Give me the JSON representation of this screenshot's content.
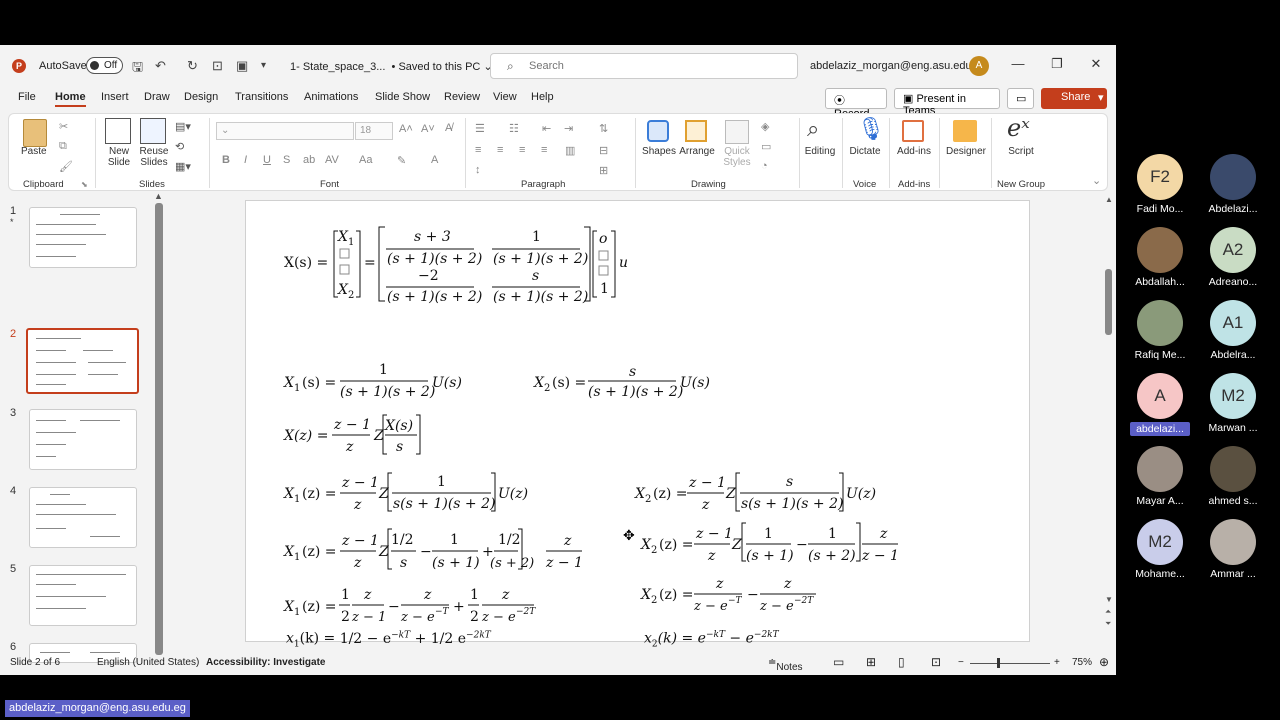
{
  "titlebar": {
    "autosave_label": "AutoSave",
    "autosave_state": "Off",
    "file_name": "1- State_space_3...",
    "save_status": "Saved to this PC",
    "search_placeholder": "Search",
    "user_email": "abdelaziz_morgan@eng.asu.edu.eg",
    "user_initial": "A"
  },
  "tabs": [
    "File",
    "Home",
    "Insert",
    "Draw",
    "Design",
    "Transitions",
    "Animations",
    "Slide Show",
    "Review",
    "View",
    "Help"
  ],
  "actions": {
    "record": "Record",
    "present": "Present in Teams",
    "share": "Share"
  },
  "ribbon": {
    "groups": [
      "Clipboard",
      "Slides",
      "Font",
      "Paragraph",
      "Drawing",
      "Voice",
      "Add-ins",
      "New Group"
    ],
    "paste": "Paste",
    "new_slide": "New Slide",
    "reuse_slides": "Reuse Slides",
    "font_size": "18",
    "shapes": "Shapes",
    "arrange": "Arrange",
    "quick_styles": "Quick Styles",
    "editing": "Editing",
    "dictate": "Dictate",
    "addins": "Add-ins",
    "designer": "Designer",
    "script": "Script"
  },
  "thumbnails": [
    "1",
    "2",
    "3",
    "4",
    "5",
    "6"
  ],
  "slide": {
    "l1_xs": "X(s) =",
    "x1": "X",
    "sub1": "1",
    "x2": "X",
    "sub2": "2",
    "eq": "=",
    "m_n11": "s + 3",
    "m_d": "(s + 1)(s + 2)",
    "m_n12": "1",
    "m_n21": "−2",
    "m_n22": "s",
    "v_o": "o",
    "v_1": "1",
    "u": "u",
    "x1s_lhs": "X",
    "x1s_arg": "(s) =",
    "x1s_num": "1",
    "x1s_den": "(s + 1)(s + 2)",
    "us": "U(s)",
    "x2s_num": "s",
    "xz_lhs": "X(z) =",
    "zm1": "z − 1",
    "z": "z",
    "Z": "Z",
    "xs": "X(s)",
    "s": "s",
    "x1z_den": "s(s + 1)(s + 2)",
    "uz": "U(z)",
    "xz_arg": "(z) =",
    "half_s": "1/2",
    "s1": "(s + 1)",
    "s2": "(s + 2)",
    "ze1": "z − e",
    "ze2": "z − e",
    "exp1": "−T",
    "exp2": "−2T",
    "half": "1",
    "two": "2",
    "minus": "−",
    "plus": "+",
    "xk_lhs": "x",
    "xk_arg": "(k) =",
    "x1k_tail1": "− e",
    "x1k_tail2": "+",
    "expk": "−kT",
    "expk2": "−2kT",
    "x2k_rhs": "(k) = e"
  },
  "status": {
    "slide_info": "Slide 2 of 6",
    "language": "English (United States)",
    "accessibility": "Accessibility: Investigate",
    "notes": "Notes",
    "zoom": "75%"
  },
  "participants": [
    {
      "initials": "F2",
      "name": "Fadi Mo...",
      "color": "#f3d8a6"
    },
    {
      "initials": "",
      "name": "Abdelazi...",
      "color": "#3a4a6b"
    },
    {
      "initials": "",
      "name": "Abdallah...",
      "color": "#8a6a4a"
    },
    {
      "initials": "A2",
      "name": "Adreano...",
      "color": "#c9dcc4"
    },
    {
      "initials": "",
      "name": "Rafiq Me...",
      "color": "#8a9a7a"
    },
    {
      "initials": "A1",
      "name": "Abdelra...",
      "color": "#bfe3e6"
    },
    {
      "initials": "A",
      "name": "abdelazi...",
      "color": "#f6c6c6"
    },
    {
      "initials": "M2",
      "name": "Marwan ...",
      "color": "#bfe3e6"
    },
    {
      "initials": "",
      "name": "Mayar A...",
      "color": "#9a8e84"
    },
    {
      "initials": "",
      "name": "ahmed s...",
      "color": "#5a5040"
    },
    {
      "initials": "M2",
      "name": "Mohame...",
      "color": "#c9cdea"
    },
    {
      "initials": "",
      "name": "Ammar ...",
      "color": "#b8b0a8"
    }
  ],
  "bottom_tag": "abdelaziz_morgan@eng.asu.edu.eg"
}
